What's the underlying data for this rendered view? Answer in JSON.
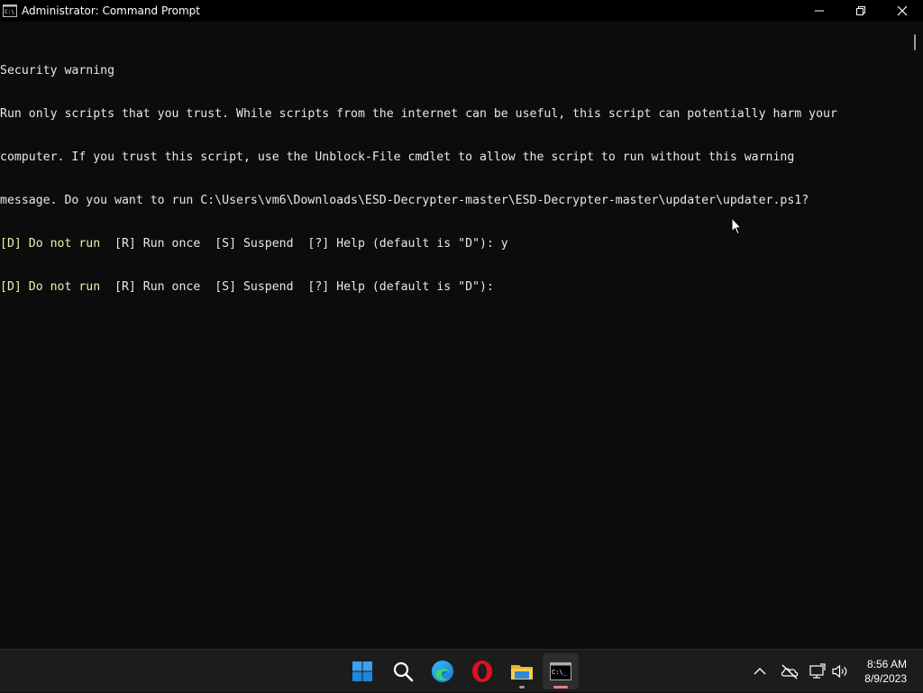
{
  "window": {
    "title": "Administrator: Command Prompt",
    "icon": "cmd-icon",
    "controls": [
      "minimize-icon",
      "restore-icon",
      "close-icon"
    ]
  },
  "console": {
    "lines": [
      {
        "text": "Security warning"
      },
      {
        "text": "Run only scripts that you trust. While scripts from the internet can be useful, this script can potentially harm your"
      },
      {
        "text": "computer. If you trust this script, use the Unblock-File cmdlet to allow the script to run without this warning"
      },
      {
        "text": "message. Do you want to run C:\\Users\\vm6\\Downloads\\ESD-Decrypter-master\\ESD-Decrypter-master\\updater\\updater.ps1?"
      },
      {
        "option": "[D] Do not run",
        "rest": "  [R] Run once  [S] Suspend  [?] Help (default is \"D\"): y"
      },
      {
        "option": "[D] Do not run",
        "rest": "  [R] Run once  [S] Suspend  [?] Help (default is \"D\"):"
      }
    ],
    "colors": {
      "text": "#e8e8e8",
      "highlight": "#f0f0b0",
      "background": "#0c0c0c"
    }
  },
  "taskbar": {
    "apps": [
      {
        "name": "start-icon",
        "active": false
      },
      {
        "name": "search-icon",
        "active": false
      },
      {
        "name": "edge-icon",
        "active": false
      },
      {
        "name": "opera-icon",
        "active": false
      },
      {
        "name": "file-explorer-icon",
        "active": false,
        "running": true
      },
      {
        "name": "terminal-icon",
        "active": true,
        "running": true
      }
    ],
    "tray": [
      "chevron-up-icon",
      "onedrive-offline-icon",
      "network-icon",
      "volume-icon"
    ],
    "clock": {
      "time": "8:56 AM",
      "date": "8/9/2023"
    }
  }
}
